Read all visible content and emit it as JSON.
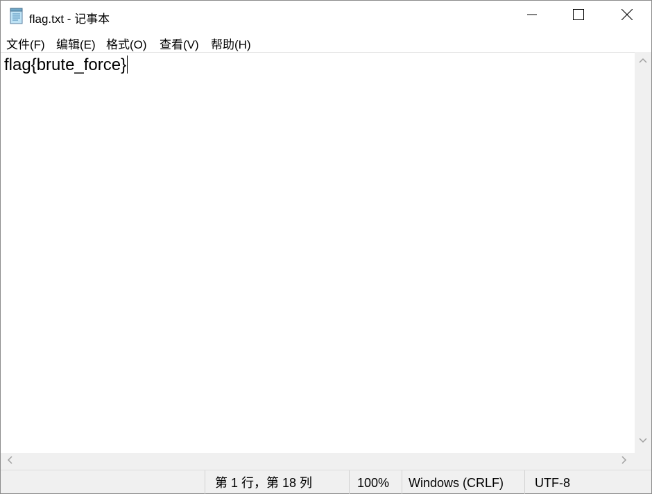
{
  "window": {
    "title": "flag.txt - 记事本",
    "app_icon": "notepad-icon",
    "controls": {
      "minimize": "minimize-icon",
      "maximize": "maximize-icon",
      "close": "close-icon"
    }
  },
  "menu": {
    "items": [
      {
        "label": "文件(F)"
      },
      {
        "label": "编辑(E)"
      },
      {
        "label": "格式(O)"
      },
      {
        "label": "查看(V)"
      },
      {
        "label": "帮助(H)"
      }
    ]
  },
  "editor": {
    "content": "flag{brute_force}"
  },
  "scrollbars": {
    "vertical": {
      "up_icon": "chevron-up-icon",
      "down_icon": "chevron-down-icon"
    },
    "horizontal": {
      "left_icon": "chevron-left-icon",
      "right_icon": "chevron-right-icon"
    }
  },
  "status": {
    "position": "第 1 行，第 18 列",
    "zoom": "100%",
    "line_ending": "Windows (CRLF)",
    "encoding": "UTF-8"
  },
  "colors": {
    "chrome_background": "#f0f0f0",
    "editor_background": "#ffffff",
    "text": "#000000"
  }
}
